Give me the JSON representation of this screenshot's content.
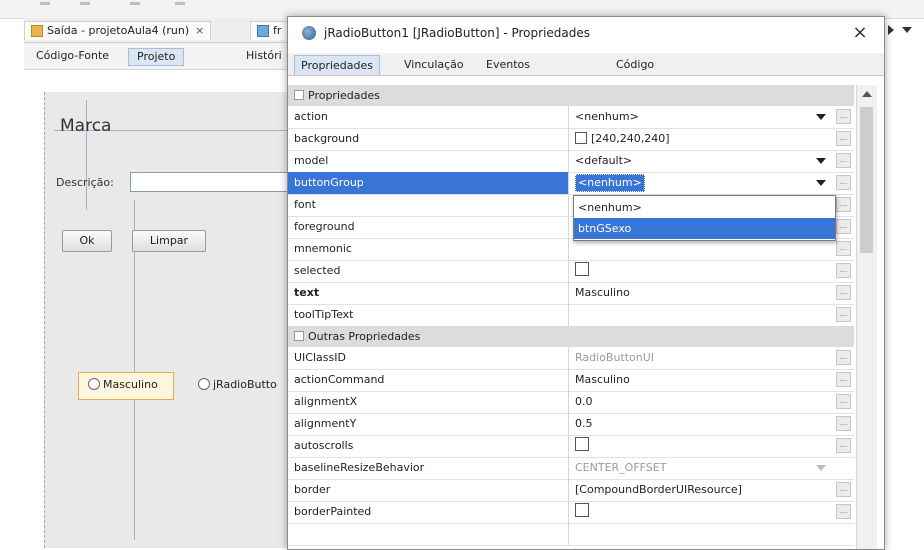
{
  "ide": {
    "tabs": [
      {
        "label": "Saída - projetoAula4 (run)",
        "close": "×"
      },
      {
        "label": "fr"
      }
    ],
    "subtabs": [
      "Código-Fonte",
      "Projeto",
      "Históri"
    ],
    "form": {
      "title_label": "Marca",
      "description_label": "Descrição:",
      "ok_button": "Ok",
      "clear_button": "Limpar",
      "radio1": "Masculino",
      "radio2": "jRadioButto"
    }
  },
  "dialog": {
    "title": "jRadioButton1 [JRadioButton] - Propriedades",
    "close": "×",
    "tabs": [
      "Propriedades",
      "Vinculação",
      "Eventos",
      "Código"
    ],
    "sections": [
      "Propriedades",
      "Outras Propriedades"
    ],
    "rows1": [
      {
        "name": "action",
        "value": "<nenhum>"
      },
      {
        "name": "background",
        "value": "[240,240,240]"
      },
      {
        "name": "model",
        "value": "<default>"
      },
      {
        "name": "buttonGroup",
        "value": "<nenhum>"
      },
      {
        "name": "font",
        "value": ""
      },
      {
        "name": "foreground",
        "value": ""
      },
      {
        "name": "mnemonic",
        "value": ""
      },
      {
        "name": "selected",
        "value": ""
      },
      {
        "name": "text",
        "value": "Masculino"
      },
      {
        "name": "toolTipText",
        "value": ""
      }
    ],
    "rows2": [
      {
        "name": "UIClassID",
        "value": "RadioButtonUI"
      },
      {
        "name": "actionCommand",
        "value": "Masculino"
      },
      {
        "name": "alignmentX",
        "value": "0.0"
      },
      {
        "name": "alignmentY",
        "value": "0.5"
      },
      {
        "name": "autoscrolls",
        "value": ""
      },
      {
        "name": "baselineResizeBehavior",
        "value": "CENTER_OFFSET"
      },
      {
        "name": "border",
        "value": "[CompoundBorderUIResource]"
      },
      {
        "name": "borderPainted",
        "value": ""
      }
    ],
    "dropdown_options": [
      "<nenhum>",
      "btnGSexo"
    ],
    "ellipsis": "..."
  },
  "colors": {
    "selection": "#3875d6",
    "section": "#dcdcdc"
  }
}
